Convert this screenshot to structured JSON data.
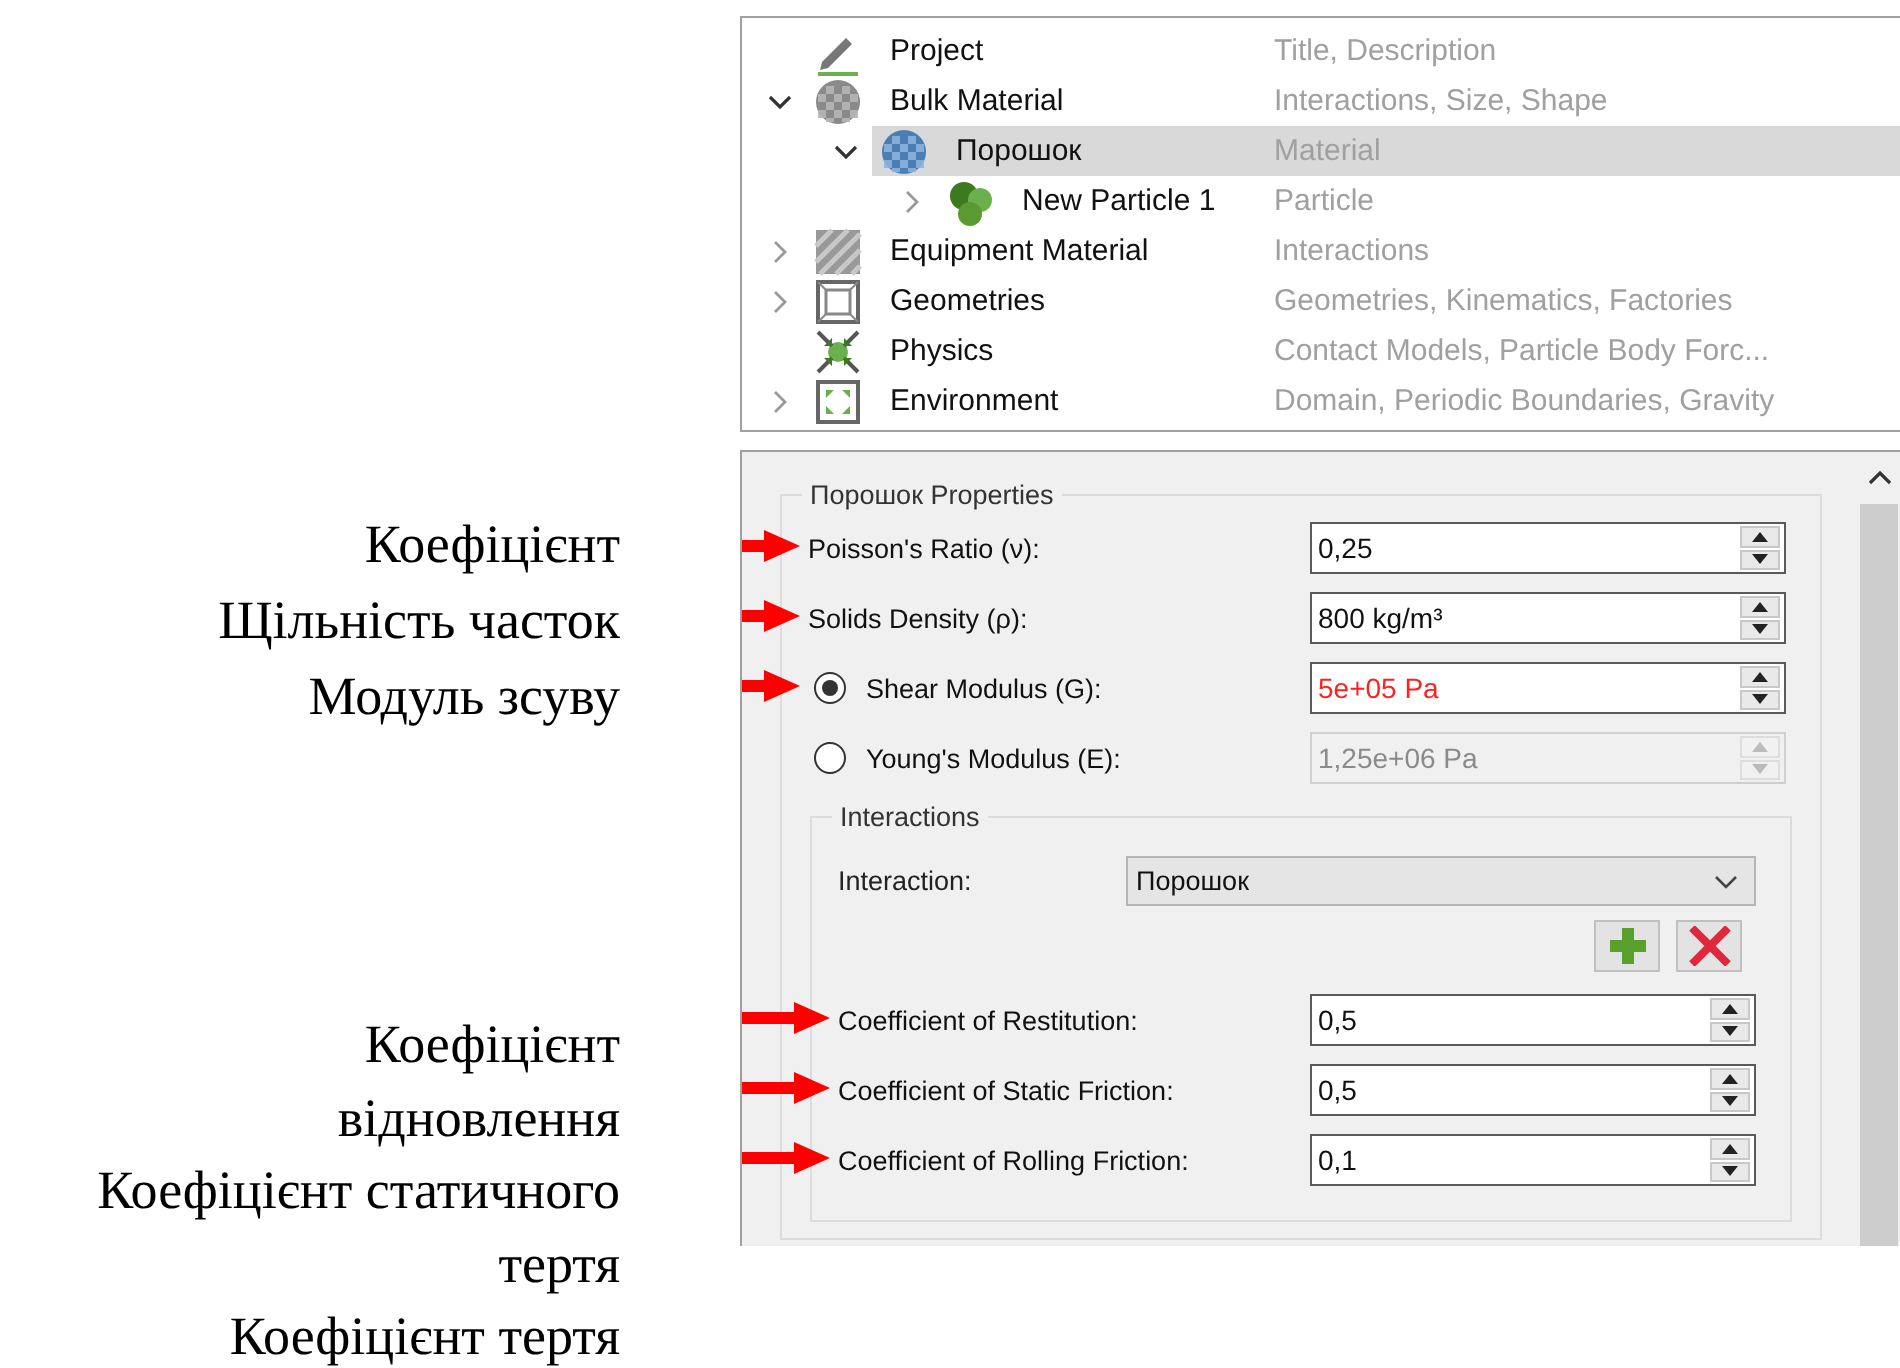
{
  "annotations_top": [
    "Коефіцієнт",
    "Щільність часток",
    "Модуль зсуву"
  ],
  "annotations_bottom": [
    "Коефіцієнт",
    "відновлення",
    "Коефіцієнт статичного",
    "тертя",
    "Коефіцієнт тертя"
  ],
  "tree": [
    {
      "kind": "project",
      "name": "Project",
      "description": "Title, Description",
      "expandable": false,
      "selected": false
    },
    {
      "kind": "bulk",
      "name": "Bulk Material",
      "description": "Interactions, Size, Shape",
      "expandable": true,
      "expanded": true,
      "selected": false,
      "children": [
        {
          "kind": "material",
          "name": "Порошок",
          "description": "Material",
          "expandable": true,
          "expanded": true,
          "selected": true,
          "children": [
            {
              "kind": "particle",
              "name": "New Particle 1",
              "description": "Particle",
              "expandable": true,
              "expanded": false,
              "selected": false
            }
          ]
        }
      ]
    },
    {
      "kind": "equipment",
      "name": "Equipment Material",
      "description": "Interactions",
      "expandable": true,
      "expanded": false,
      "selected": false
    },
    {
      "kind": "geometries",
      "name": "Geometries",
      "description": "Geometries, Kinematics, Factories",
      "expandable": true,
      "expanded": false,
      "selected": false
    },
    {
      "kind": "physics",
      "name": "Physics",
      "description": "Contact Models, Particle Body Forc...",
      "expandable": false,
      "selected": false
    },
    {
      "kind": "environment",
      "name": "Environment",
      "description": "Domain, Periodic Boundaries, Gravity",
      "expandable": true,
      "expanded": false,
      "selected": false
    }
  ],
  "properties": {
    "title": "Порошок Properties",
    "fields": [
      {
        "kind": "spin",
        "label": "Poisson's Ratio (ν):",
        "value": "0,25",
        "arrow": true,
        "invalid": false,
        "disabled": false
      },
      {
        "kind": "spin",
        "label": "Solids Density (ρ):",
        "value": "800 kg/m³",
        "arrow": true,
        "invalid": false,
        "disabled": false
      },
      {
        "kind": "radio",
        "label": "Shear Modulus (G):",
        "value": "5e+05 Pa",
        "selected": true,
        "arrow": true,
        "invalid": true,
        "disabled": false
      },
      {
        "kind": "radio",
        "label": "Young's Modulus (E):",
        "value": "1,25e+06 Pa",
        "selected": false,
        "arrow": false,
        "invalid": false,
        "disabled": true
      }
    ]
  },
  "interactions": {
    "title": "Interactions",
    "label": "Interaction:",
    "value": "Порошок",
    "coefficients": [
      {
        "label": "Coefficient of Restitution:",
        "value": "0,5",
        "arrow": true
      },
      {
        "label": "Coefficient of Static Friction:",
        "value": "0,5",
        "arrow": true
      },
      {
        "label": "Coefficient of Rolling Friction:",
        "value": "0,1",
        "arrow": true
      }
    ]
  }
}
